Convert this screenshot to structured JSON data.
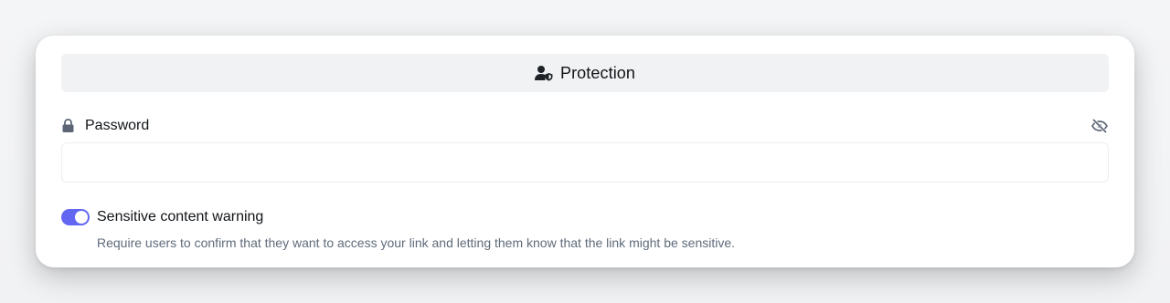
{
  "protection": {
    "header_icon": "user-shield-icon",
    "title": "Protection"
  },
  "password": {
    "icon": "lock-icon",
    "label": "Password",
    "visibility_icon": "eye-slash-icon",
    "value": "",
    "placeholder": ""
  },
  "sensitive": {
    "label": "Sensitive content warning",
    "enabled": true,
    "description": "Require users to confirm that they want to access your link and letting them know that the link might be sensitive."
  },
  "colors": {
    "accent": "#6366f1",
    "header_bg": "#f1f2f4",
    "text": "#111418",
    "muted": "#5f6b7a"
  }
}
